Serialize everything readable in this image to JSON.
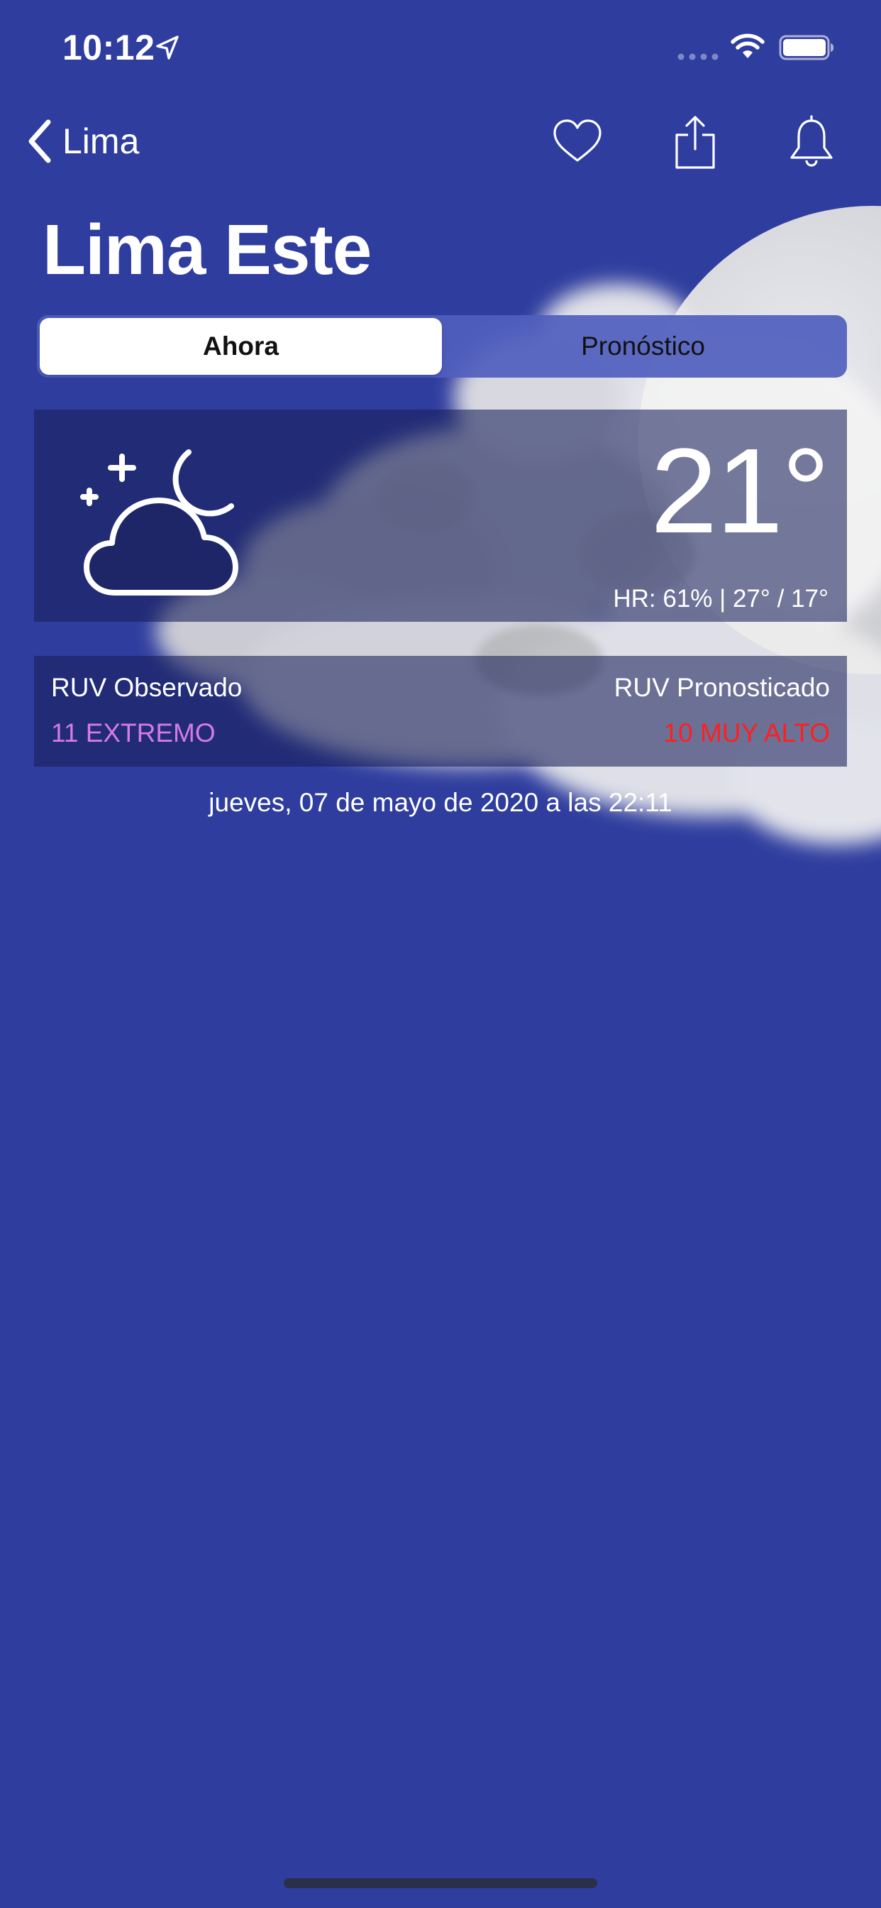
{
  "status_bar": {
    "time": "10:12",
    "icons": [
      "location-arrow-icon",
      "signal-dots-icon",
      "wifi-icon",
      "battery-icon"
    ]
  },
  "nav": {
    "back_label": "Lima",
    "actions": [
      "heart-icon",
      "share-icon",
      "bell-icon"
    ]
  },
  "title": "Lima Este",
  "tabs": [
    {
      "label": "Ahora",
      "selected": true
    },
    {
      "label": "Pronóstico",
      "selected": false
    }
  ],
  "current": {
    "icon": "night-partly-cloudy-icon",
    "temperature": "21°",
    "details": "HR: 61% | 27° / 17°"
  },
  "uv": {
    "observed_label": "RUV Observado",
    "observed_value": "11 EXTREMO",
    "observed_color": "#d57ae6",
    "forecast_label": "RUV Pronosticado",
    "forecast_value": "10 MUY ALTO",
    "forecast_color": "#ff1f1f"
  },
  "timestamp": "jueves, 07 de mayo de 2020 a las 22:11",
  "colors": {
    "background": "#2f3d9e",
    "card": "#181f5a"
  }
}
